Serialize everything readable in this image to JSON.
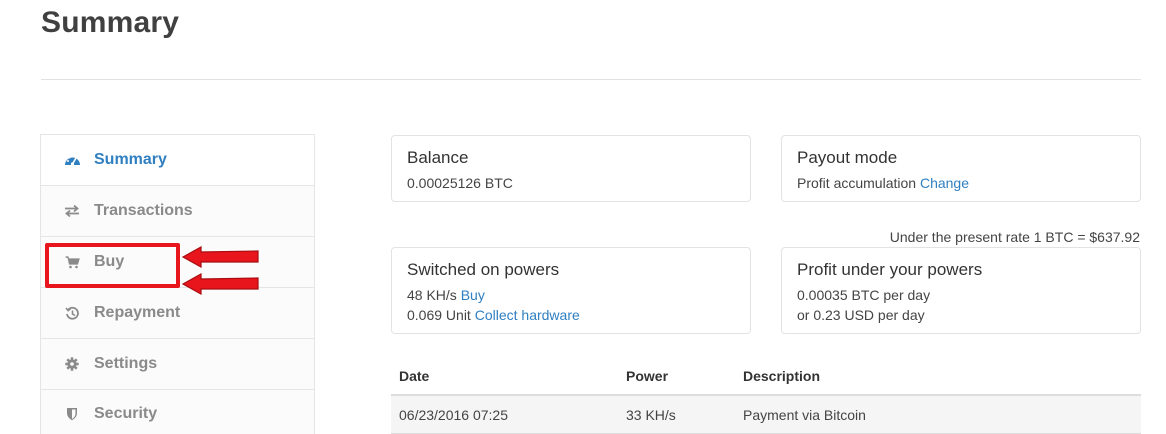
{
  "page": {
    "title": "Summary"
  },
  "sidebar": {
    "items": [
      {
        "label": "Summary",
        "icon": "dashboard-icon",
        "active": true
      },
      {
        "label": "Transactions",
        "icon": "exchange-icon",
        "active": false
      },
      {
        "label": "Buy",
        "icon": "cart-icon",
        "active": false
      },
      {
        "label": "Repayment",
        "icon": "history-icon",
        "active": false
      },
      {
        "label": "Settings",
        "icon": "gear-icon",
        "active": false
      },
      {
        "label": "Security",
        "icon": "shield-icon",
        "active": false
      }
    ]
  },
  "cards": {
    "balance": {
      "title": "Balance",
      "value": "0.00025126 BTC"
    },
    "payout": {
      "title": "Payout mode",
      "text": "Profit accumulation",
      "link": "Change"
    },
    "powers": {
      "title": "Switched on powers",
      "power_text": "48 KH/s",
      "power_link": "Buy",
      "unit_text": "0.069 Unit",
      "unit_link": "Collect hardware"
    },
    "profit": {
      "title": "Profit under your powers",
      "btc_line": "0.00035 BTC per day",
      "usd_line": "or 0.23 USD per day"
    }
  },
  "rate_note": "Under the present rate 1 BTC = $637.92",
  "table": {
    "headers": [
      "Date",
      "Power",
      "Description"
    ],
    "rows": [
      [
        "06/23/2016 07:25",
        "33 KH/s",
        "Payment via Bitcoin"
      ]
    ]
  },
  "colors": {
    "accent": "#2f7fc1",
    "annotation": "#e8161c"
  }
}
